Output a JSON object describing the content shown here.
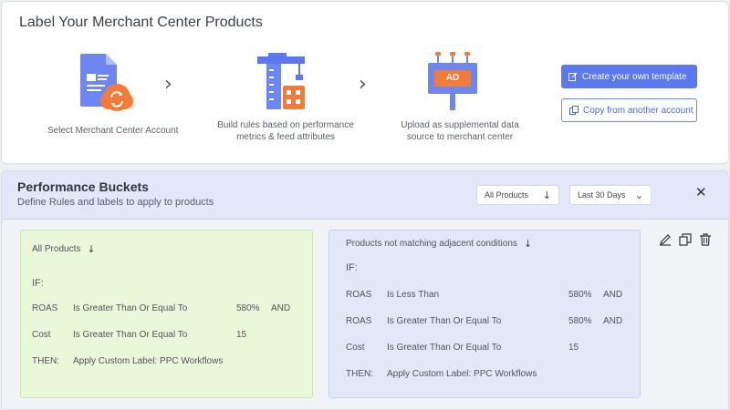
{
  "header": {
    "title": "Label Your Merchant Center Products"
  },
  "steps": [
    {
      "icon": "merchant-account-icon",
      "lines": [
        "Select Merchant Center Account"
      ]
    },
    {
      "icon": "build-rules-icon",
      "lines": [
        "Build rules based on performance",
        "metrics & feed attributes"
      ]
    },
    {
      "icon": "billboard-ad-icon",
      "ad_text": "AD",
      "lines": [
        "Upload as supplemental data",
        "source to merchant center"
      ]
    }
  ],
  "actions": {
    "create_template": "Create your own template",
    "copy_account": "Copy from another account"
  },
  "performance": {
    "title": "Performance Buckets",
    "subtitle": "Define Rules and labels to apply to products",
    "product_filter": "All Products",
    "date_range": "Last 30 Days"
  },
  "rules": [
    {
      "heading": "All Products",
      "if_label": "IF:",
      "conditions": [
        {
          "metric": "ROAS",
          "operator": "Is Greater Than Or Equal To",
          "value": "580%",
          "join": "AND"
        },
        {
          "metric": "Cost",
          "operator": "Is Greater Than Or Equal To",
          "value": "15",
          "join": ""
        }
      ],
      "then_label": "THEN:",
      "then_action": "Apply Custom Label: PPC Workflows"
    },
    {
      "heading": "Products not matching adjacent conditions",
      "if_label": "IF:",
      "conditions": [
        {
          "metric": "ROAS",
          "operator": "Is Less Than",
          "value": "580%",
          "join": "AND"
        },
        {
          "metric": "ROAS",
          "operator": "Is Greater Than Or Equal To",
          "value": "580%",
          "join": "AND"
        },
        {
          "metric": "Cost",
          "operator": "Is Greater Than Or Equal To",
          "value": "15",
          "join": ""
        }
      ],
      "then_label": "THEN:",
      "then_action": "Apply Custom Label: PPC Workflows"
    }
  ],
  "colors": {
    "accent": "#5b78ef",
    "orange": "#f47a3a",
    "green_card": "#e9f8d9",
    "blue_card": "#e4e8f6"
  }
}
